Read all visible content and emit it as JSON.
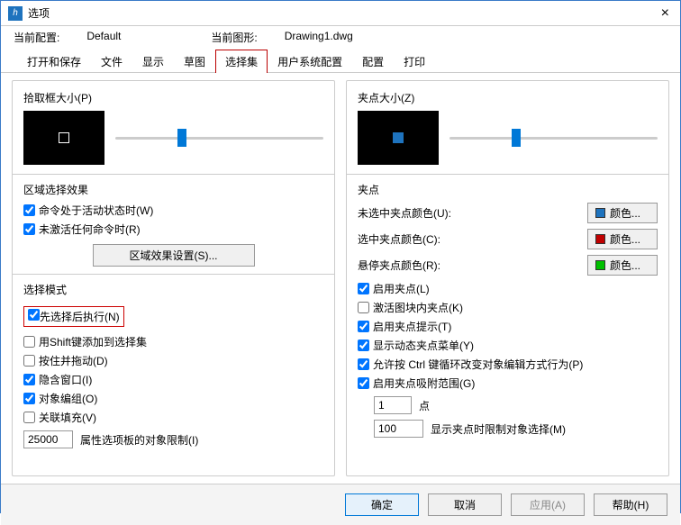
{
  "title": "选项",
  "info": {
    "cfg_label": "当前配置:",
    "cfg_value": "Default",
    "dwg_label": "当前图形:",
    "dwg_value": "Drawing1.dwg"
  },
  "tabs": [
    "打开和保存",
    "文件",
    "显示",
    "草图",
    "选择集",
    "用户系统配置",
    "配置",
    "打印"
  ],
  "left": {
    "pickbox_label": "拾取框大小(P)",
    "area_title": "区域选择效果",
    "chk_active": "命令处于活动状态时(W)",
    "chk_nocmd": "未激活任何命令时(R)",
    "area_settings_btn": "区域效果设置(S)...",
    "mode_title": "选择模式",
    "chk_prepost": "先选择后执行(N)",
    "chk_shift": "用Shift键添加到选择集",
    "chk_pressdrag": "按住并拖动(D)",
    "chk_implied": "隐含窗口(I)",
    "chk_group": "对象编组(O)",
    "chk_hatch": "关联填充(V)",
    "limit_value": "25000",
    "limit_label": "属性选项板的对象限制(I)"
  },
  "right": {
    "gripsize_label": "夹点大小(Z)",
    "grips_title": "夹点",
    "c_unsel_label": "未选中夹点颜色(U):",
    "c_sel_label": "选中夹点颜色(C):",
    "c_hover_label": "悬停夹点颜色(R):",
    "color_btn": "颜色...",
    "colors": {
      "unsel": "#1e73be",
      "sel": "#c00000",
      "hover": "#00c000"
    },
    "chk_enable": "启用夹点(L)",
    "chk_blockgrips": "激活图块内夹点(K)",
    "chk_tips": "启用夹点提示(T)",
    "chk_dynmenu": "显示动态夹点菜单(Y)",
    "chk_ctrlcycle": "允许按 Ctrl 键循环改变对象编辑方式行为(P)",
    "chk_snaprange": "启用夹点吸附范围(G)",
    "dot_value": "1",
    "dot_label": "点",
    "griplimit_value": "100",
    "griplimit_label": "显示夹点时限制对象选择(M)"
  },
  "footer": {
    "ok": "确定",
    "cancel": "取消",
    "apply": "应用(A)",
    "help": "帮助(H)"
  }
}
